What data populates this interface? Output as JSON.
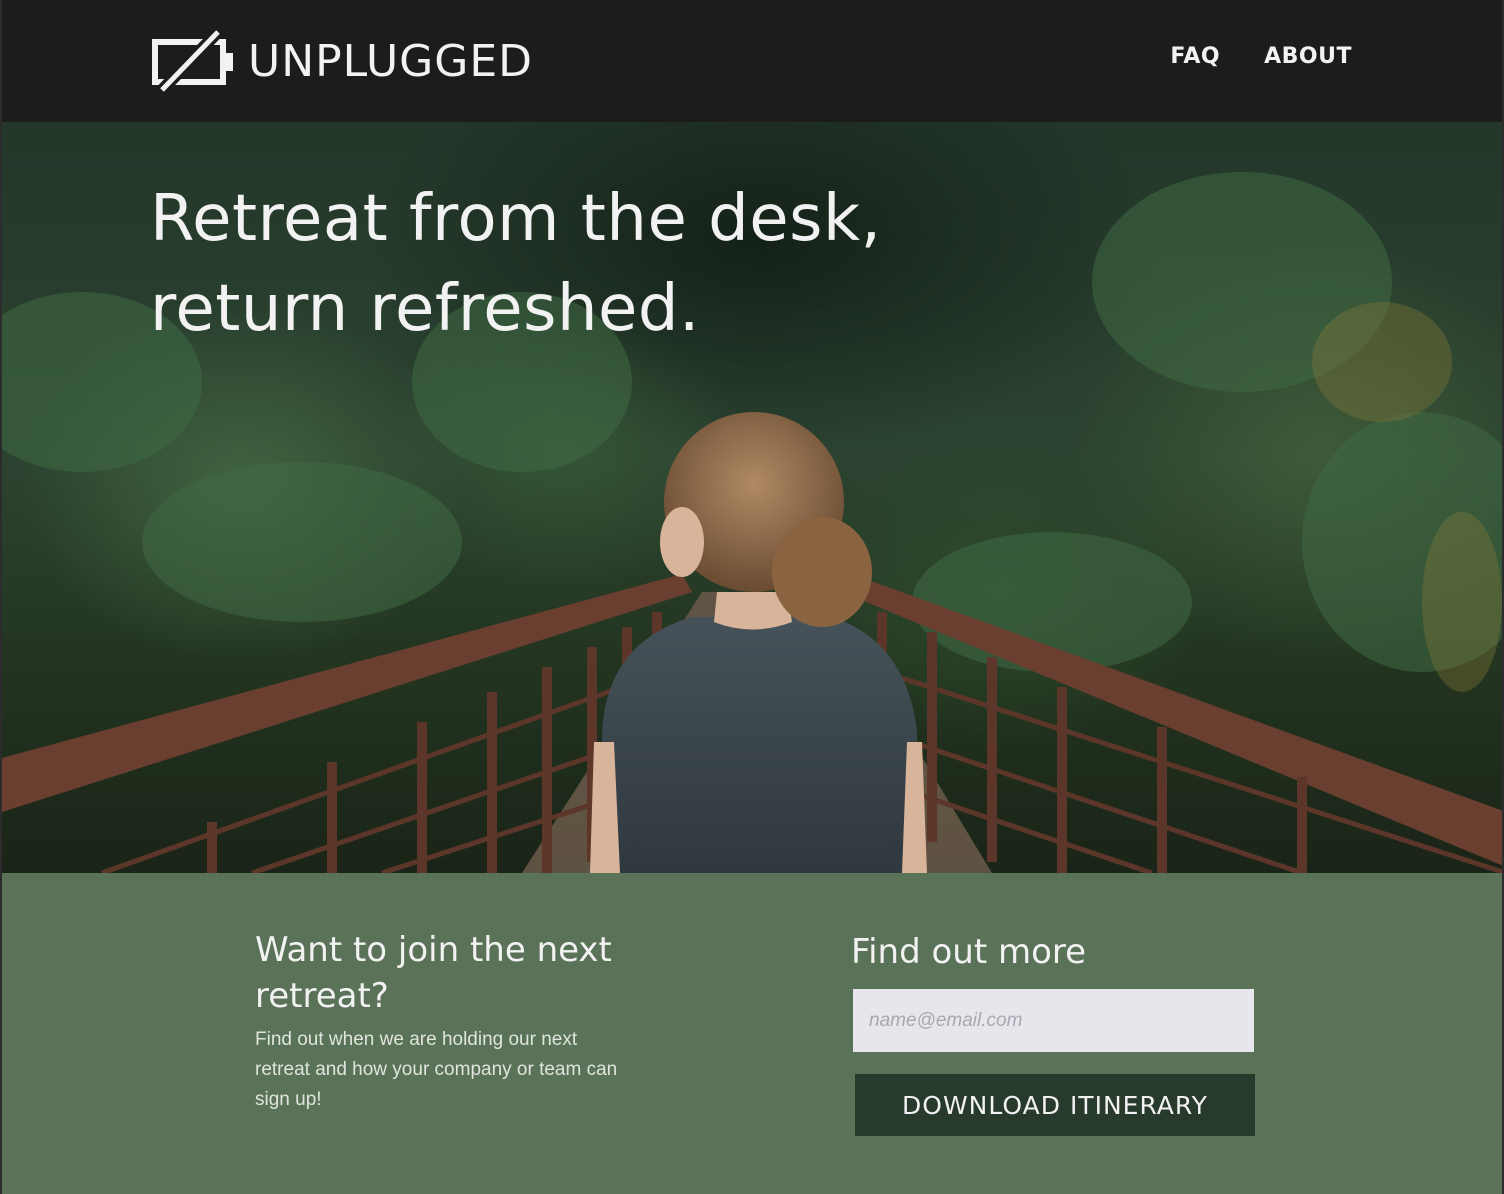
{
  "brand": {
    "name": "UNPLUGGED",
    "icon": "battery-crossed-icon"
  },
  "nav": {
    "items": [
      {
        "label": "FAQ"
      },
      {
        "label": "ABOUT"
      }
    ]
  },
  "hero": {
    "title_line1": "Retreat from the desk,",
    "title_line2": "return refreshed.",
    "image": "woman-on-forest-bridge-photo"
  },
  "signup": {
    "join_heading": "Want to join the next retreat?",
    "join_text": "Find out when we are holding our next retreat and how your company or team can sign up!",
    "more_heading": "Find out more",
    "email_placeholder": "name@email.com",
    "button_label": "DOWNLOAD ITINERARY"
  },
  "colors": {
    "navbar": "#1c1c1c",
    "signup_bg": "#5a7257",
    "button_bg": "#283a2c",
    "input_bg": "#e6e6ec"
  }
}
